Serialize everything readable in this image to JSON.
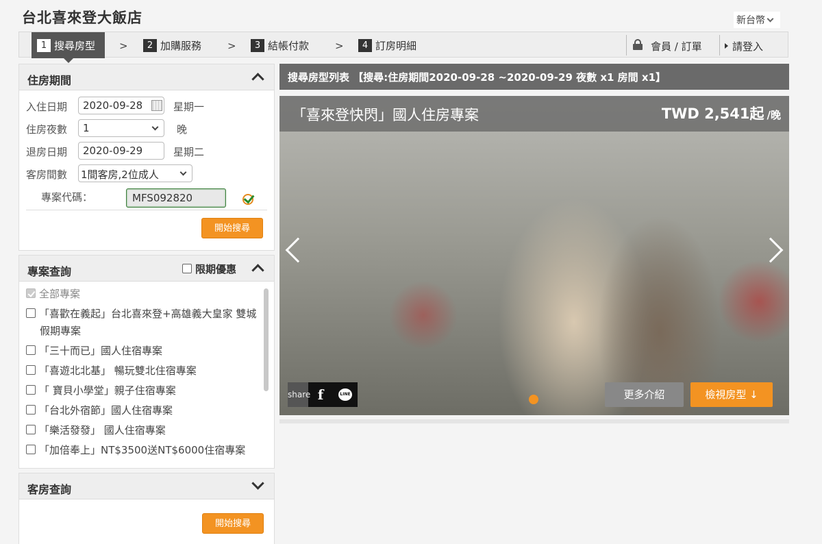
{
  "header": {
    "hotel_name": "台北喜來登大飯店",
    "currency": "新台幣"
  },
  "steps": [
    {
      "num": "1",
      "label": "搜尋房型"
    },
    {
      "num": "2",
      "label": "加購服務"
    },
    {
      "num": "3",
      "label": "結帳付款"
    },
    {
      "num": "4",
      "label": "訂房明細"
    }
  ],
  "step_separator": ">",
  "account": {
    "member": "會員 / 訂單",
    "login": "請登入"
  },
  "stay_panel": {
    "title": "住房期間",
    "checkin_label": "入住日期",
    "checkin_value": "2020-09-28",
    "checkin_weekday": "星期一",
    "nights_label": "住房夜數",
    "nights_value": "1",
    "nights_unit": "晚",
    "checkout_label": "退房日期",
    "checkout_value": "2020-09-29",
    "checkout_weekday": "星期二",
    "rooms_label": "客房間數",
    "rooms_value": "1間客房,2位成人",
    "promo_label": "專案代碼：",
    "promo_value": "MFS092820",
    "search_button": "開始搜尋"
  },
  "promo_panel": {
    "title": "專案查詢",
    "limited_label": "限期優惠",
    "items": [
      {
        "label": "全部專案"
      },
      {
        "label": "「喜歡在義起」台北喜來登+高雄義大皇家 雙城假期專案"
      },
      {
        "label": "「三十而已」國人住宿專案"
      },
      {
        "label": "「喜遊北北基」 暢玩雙北住宿專案"
      },
      {
        "label": "「 寶貝小學堂」親子住宿專案"
      },
      {
        "label": "「台北外宿節」國人住宿專案"
      },
      {
        "label": "「樂活發發」 國人住宿專案"
      },
      {
        "label": "「加倍奉上」NT$3500送NT$6000住宿專案"
      }
    ]
  },
  "room_panel": {
    "title": "客房查詢",
    "search_button": "開始搜尋"
  },
  "results": {
    "heading": "搜尋房型列表 【搜尋:住房期間2020-09-28 ~2020-09-29 夜數 x1 房間 x1】",
    "package_name": "「喜來登快閃」國人住房專案",
    "price": "TWD 2,541起",
    "price_unit": "/晚",
    "share_label": "share",
    "facebook_label": "f",
    "line_label": "LINE",
    "more_button": "更多介紹",
    "view_button": "檢視房型 ↓"
  },
  "colors": {
    "accent": "#f39322",
    "dark_bar": "#6a6a6a",
    "step_active": "#555555"
  }
}
